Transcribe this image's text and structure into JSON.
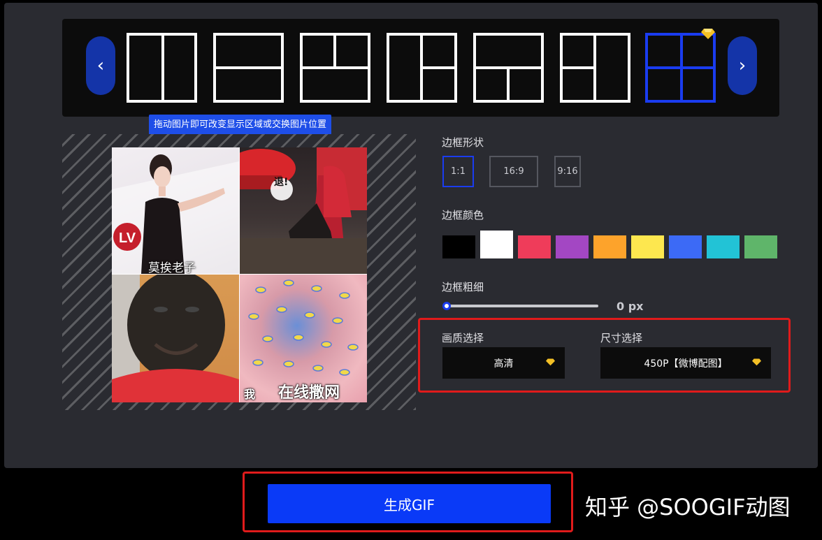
{
  "hint_text": "拖动图片即可改变显示区域或交换图片位置",
  "nav": {
    "prev_icon": "chevron-left-icon",
    "next_icon": "chevron-right-icon"
  },
  "layouts": [
    "two-columns",
    "two-rows",
    "top-split-bottom-full",
    "left-full-right-split",
    "top-full-bottom-split",
    "left-split-right-full",
    "four-grid"
  ],
  "selected_layout": "four-grid",
  "image_captions": {
    "top_left": "莫挨老子",
    "top_right": "退!",
    "bottom_right_small": "我",
    "bottom_right": "在线撒网"
  },
  "border_shape": {
    "label": "边框形状",
    "options": [
      "1:1",
      "16:9",
      "9:16"
    ],
    "selected": "1:1"
  },
  "border_color": {
    "label": "边框颜色",
    "colors": [
      "#000000",
      "#ffffff",
      "#ef3c5a",
      "#a347c3",
      "#fda32b",
      "#fde74f",
      "#3c6af6",
      "#22c3d6",
      "#5fb56a"
    ],
    "selected": "#ffffff"
  },
  "border_width": {
    "label": "边框粗细",
    "value": 0,
    "unit": "px",
    "display": "0 px"
  },
  "quality": {
    "label": "画质选择",
    "value": "高清"
  },
  "size": {
    "label": "尺寸选择",
    "value": "450P【微博配图】"
  },
  "generate_label": "生成GIF",
  "watermark": "知乎 @SOOGIF动图",
  "colors": {
    "accent": "#1a3cf0",
    "button": "#0a3af7",
    "highlight": "#e01b1b",
    "vip": "#f3c026"
  }
}
